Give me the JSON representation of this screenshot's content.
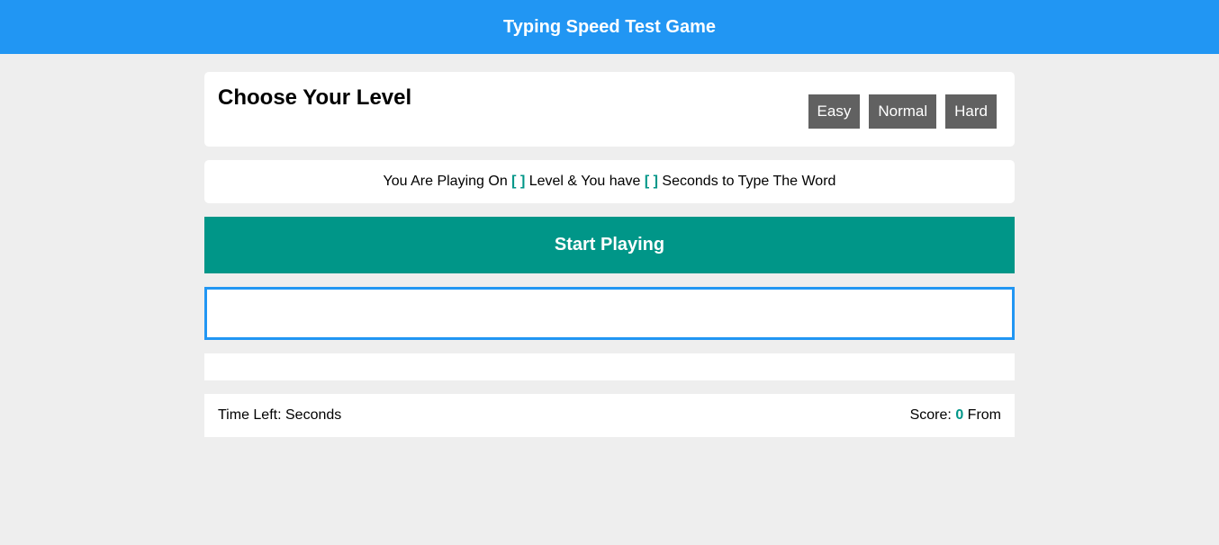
{
  "header": {
    "title": "Typing Speed Test Game"
  },
  "levels": {
    "heading": "Choose Your Level",
    "buttons": [
      "Easy",
      "Normal",
      "Hard"
    ]
  },
  "message": {
    "part1": "You Are Playing On",
    "level_placeholder": "[ ]",
    "part2": "Level & You have",
    "seconds_placeholder": "[ ]",
    "part3": "Seconds to Type The Word"
  },
  "start_button": "Start Playing",
  "input": {
    "value": "",
    "placeholder": ""
  },
  "control": {
    "time_label": "Time Left:",
    "time_value": "",
    "time_unit": "Seconds",
    "score_label": "Score:",
    "score_value": "0",
    "score_from": "From"
  },
  "colors": {
    "header": "#2196f3",
    "accent": "#009688",
    "level_button": "#616161",
    "background": "#eeeeee"
  }
}
